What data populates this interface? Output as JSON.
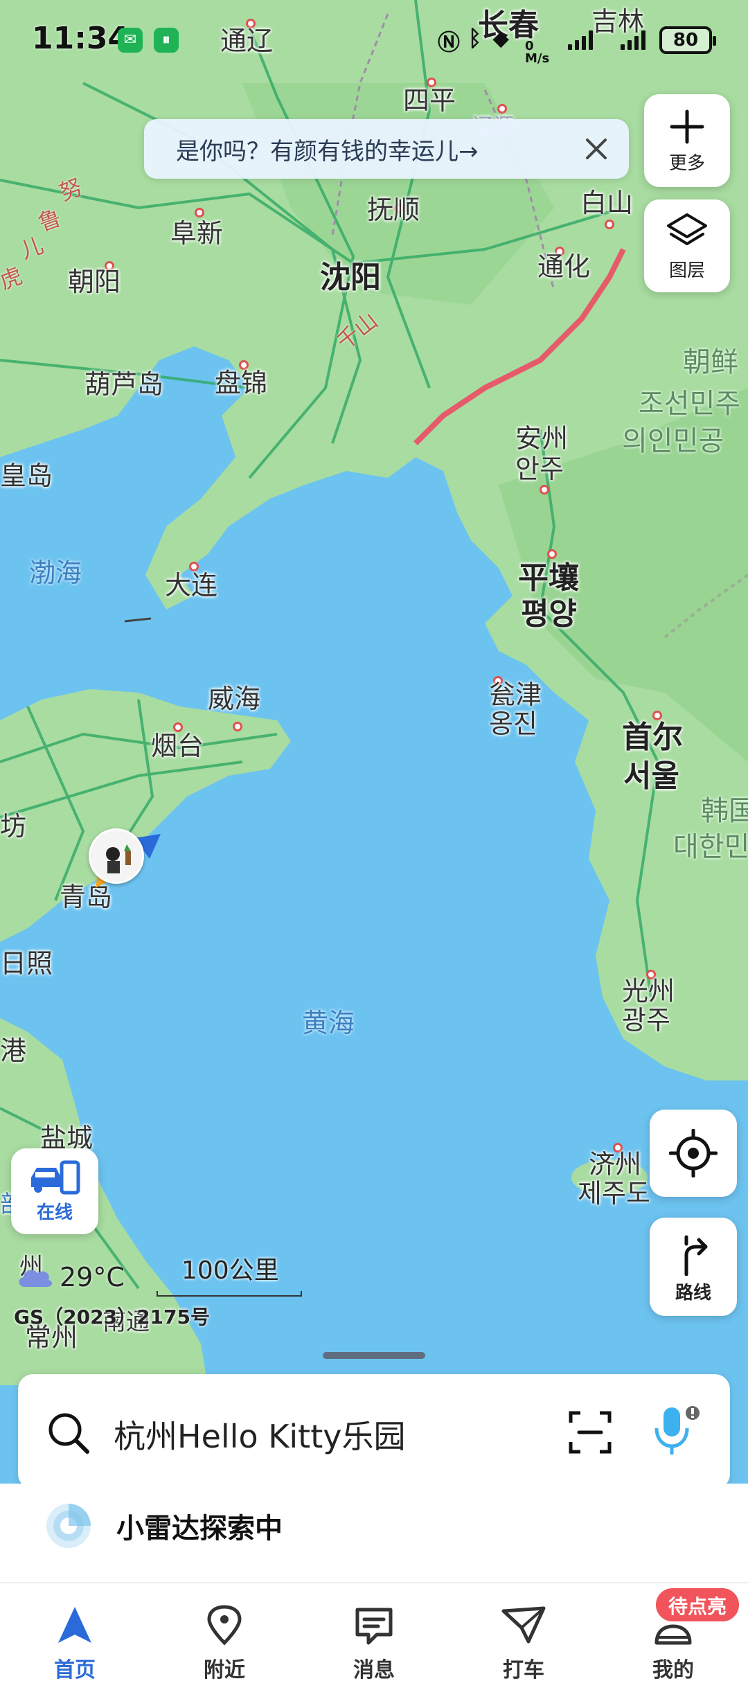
{
  "status_bar": {
    "time": "11:34",
    "speed_value": "0",
    "speed_unit": "M/s",
    "battery": "80",
    "apps": [
      "wechat-icon",
      "app-icon"
    ]
  },
  "promo_banner": {
    "text": "是你吗？有颜有钱的幸运儿→"
  },
  "map": {
    "labels": {
      "changchun": "长春",
      "jilin": "吉林",
      "tongliao": "通辽",
      "siping": "四平",
      "liaoyuan": "辽源",
      "fushun": "抚顺",
      "fuxin": "阜新",
      "baishan": "白山",
      "shenyang": "沈阳",
      "chaoyang": "朝阳",
      "tonghua": "通化",
      "huludao": "葫芦岛",
      "panjin": "盘锦",
      "anzhou": "安州",
      "anzhou_ko": "안주",
      "huangdao": "皇岛",
      "bohai": "渤海",
      "dalian": "大连",
      "pyongyang": "平壤",
      "pyongyang_ko": "평양",
      "weihai": "威海",
      "ongjin": "瓮津",
      "ongjin_ko": "옹진",
      "yantai": "烟台",
      "seoul": "首尔",
      "seoul_ko": "서울",
      "fang": "坊",
      "qingdao": "青岛",
      "rizhao": "日照",
      "gwangju": "光州",
      "gwangju_ko": "광주",
      "yellow_sea": "黄海",
      "gang": "港",
      "yancheng": "盐城",
      "jeju": "济州",
      "jeju_ko": "제주도",
      "changzhou": "常州",
      "nantong": "南通",
      "north_korea": "朝鲜",
      "north_korea_ko1": "조선민주",
      "north_korea_ko2": "의인민공",
      "south_korea": "韩国",
      "south_korea_ko": "대한민",
      "road1": "努",
      "road2": "鲁",
      "road3": "儿",
      "road4": "虎",
      "road_qian": "千山",
      "bu": "部",
      "zhou": "州"
    },
    "scale_label": "100公里",
    "gs_number": "GS（2023）2175号",
    "weather_temp": "29°C"
  },
  "right_controls": {
    "more_label": "更多",
    "layers_label": "图层",
    "route_label": "路线"
  },
  "left_controls": {
    "online_label": "在线"
  },
  "search": {
    "placeholder_text": "杭州Hello Kitty乐园"
  },
  "radar": {
    "text": "小雷达探索中"
  },
  "bottom_nav": {
    "items": [
      {
        "label": "首页",
        "icon": "navigation-arrow-icon",
        "active": true
      },
      {
        "label": "附近",
        "icon": "location-pin-icon",
        "active": false
      },
      {
        "label": "消息",
        "icon": "message-icon",
        "active": false
      },
      {
        "label": "打车",
        "icon": "taxi-icon",
        "active": false
      },
      {
        "label": "我的",
        "icon": "profile-icon",
        "active": false
      }
    ],
    "mine_badge": "待点亮"
  },
  "colors": {
    "accent": "#2a6bd9",
    "sea": "#6cc3f0",
    "land": "#a8dca0",
    "badge": "#f2545b",
    "border": "#e65a6a"
  }
}
